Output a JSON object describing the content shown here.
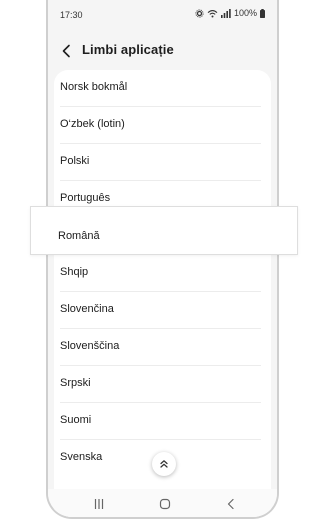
{
  "status_bar": {
    "time": "17:30",
    "battery": "100%"
  },
  "header": {
    "title": "Limbi aplicație"
  },
  "languages": [
    {
      "label": "Norsk bokmål"
    },
    {
      "label": "O‘zbek (lotin)"
    },
    {
      "label": "Polski"
    },
    {
      "label": "Português"
    },
    {
      "label": "Română",
      "highlighted": true
    },
    {
      "label": "Shqip"
    },
    {
      "label": "Slovenčina"
    },
    {
      "label": "Slovenščina"
    },
    {
      "label": "Srpski"
    },
    {
      "label": "Suomi"
    },
    {
      "label": "Svenska"
    }
  ],
  "icons": {
    "back": "back-arrow-icon",
    "scroll_top": "chevron-up-icon",
    "nav_recents": "recents-icon",
    "nav_home": "home-icon",
    "nav_back": "back-icon"
  }
}
